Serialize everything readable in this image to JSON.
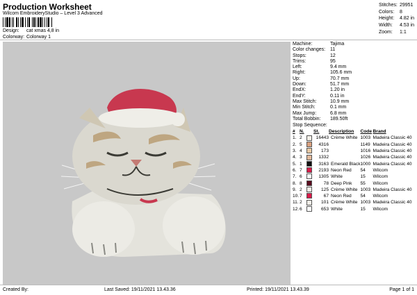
{
  "header": {
    "title": "Production Worksheet",
    "subtitle": "Wilcom EmbroideryStudio – Level 3 Advanced",
    "design_label": "Design:",
    "design_value": "cat xmas 4,8 in",
    "colorway_label": "Colorway:",
    "colorway_value": "Colorway 1"
  },
  "stats": [
    {
      "label": "Stitches:",
      "value": "29951"
    },
    {
      "label": "Colors:",
      "value": "8"
    },
    {
      "label": "Height:",
      "value": "4.82 in"
    },
    {
      "label": "Width:",
      "value": "4.53 in"
    },
    {
      "label": "Zoom:",
      "value": "1:1"
    }
  ],
  "details": [
    {
      "label": "Machine:",
      "value": "Tajima"
    },
    {
      "label": "Color changes:",
      "value": "11"
    },
    {
      "label": "Stops:",
      "value": "12"
    },
    {
      "label": "Trims:",
      "value": "95"
    },
    {
      "label": "Left:",
      "value": "9.4 mm"
    },
    {
      "label": "Right:",
      "value": "105.6 mm"
    },
    {
      "label": "Up:",
      "value": "70.7 mm"
    },
    {
      "label": "Down:",
      "value": "51.7 mm"
    },
    {
      "label": "EndX:",
      "value": "1.20 in"
    },
    {
      "label": "EndY:",
      "value": "0.11 in"
    },
    {
      "label": "Max Stitch:",
      "value": "10.9 mm"
    },
    {
      "label": "Min Stitch:",
      "value": "0.1 mm"
    },
    {
      "label": "Max Jump:",
      "value": "6.8 mm"
    },
    {
      "label": "Total Bobbin:",
      "value": "189.50ft"
    }
  ],
  "sequence": {
    "title": "Stop Sequence:",
    "headers": [
      "#",
      "N.",
      "",
      "St.",
      "Description",
      "Code",
      "Brand"
    ],
    "rows": [
      {
        "n": "1.",
        "stop": "2",
        "color": "#f4f0e8",
        "st": "16443",
        "desc": "Crème White",
        "code": "1003",
        "brand": "Madeira Classic 40"
      },
      {
        "n": "2.",
        "stop": "5",
        "color": "#d9a07e",
        "st": "4316",
        "desc": "",
        "code": "1149",
        "brand": "Madeira Classic 40"
      },
      {
        "n": "3.",
        "stop": "4",
        "color": "#e8c9a4",
        "st": "173",
        "desc": "",
        "code": "1016",
        "brand": "Madeira Classic 40"
      },
      {
        "n": "4.",
        "stop": "3",
        "color": "#e0b89a",
        "st": "1332",
        "desc": "",
        "code": "1026",
        "brand": "Madeira Classic 40"
      },
      {
        "n": "5.",
        "stop": "1",
        "color": "#111111",
        "st": "3163",
        "desc": "Emerald Black",
        "code": "1000",
        "brand": "Madeira Classic 40"
      },
      {
        "n": "6.",
        "stop": "7",
        "color": "#d81b4a",
        "st": "2193",
        "desc": "Neon Red",
        "code": "54",
        "brand": "Wilcom"
      },
      {
        "n": "7.",
        "stop": "6",
        "color": "#ffffff",
        "st": "1305",
        "desc": "White",
        "code": "15",
        "brand": "Wilcom"
      },
      {
        "n": "8.",
        "stop": "8",
        "color": "#5a0d1f",
        "st": "78",
        "desc": "Deep Pink",
        "code": "55",
        "brand": "Wilcom"
      },
      {
        "n": "9.",
        "stop": "2",
        "color": "#f4f0e8",
        "st": "125",
        "desc": "Crème White",
        "code": "1003",
        "brand": "Madeira Classic 40"
      },
      {
        "n": "10.",
        "stop": "7",
        "color": "#d81b4a",
        "st": "67",
        "desc": "Neon Red",
        "code": "54",
        "brand": "Wilcom"
      },
      {
        "n": "11.",
        "stop": "2",
        "color": "#f4f0e8",
        "st": "101",
        "desc": "Crème White",
        "code": "1003",
        "brand": "Madeira Classic 40"
      },
      {
        "n": "12.",
        "stop": "6",
        "color": "#ffffff",
        "st": "653",
        "desc": "White",
        "code": "15",
        "brand": "Wilcom"
      }
    ]
  },
  "footer": {
    "created_by": "Created By:",
    "last_saved": "Last Saved: 19/11/2021 13.43.36",
    "printed": "Printed: 19/11/2021 13.43.39",
    "page": "Page 1 of 1"
  },
  "colors": {
    "canvas": "#c8c8c8",
    "hat_red": "#c8384f",
    "fur": "#e6e4dc"
  }
}
